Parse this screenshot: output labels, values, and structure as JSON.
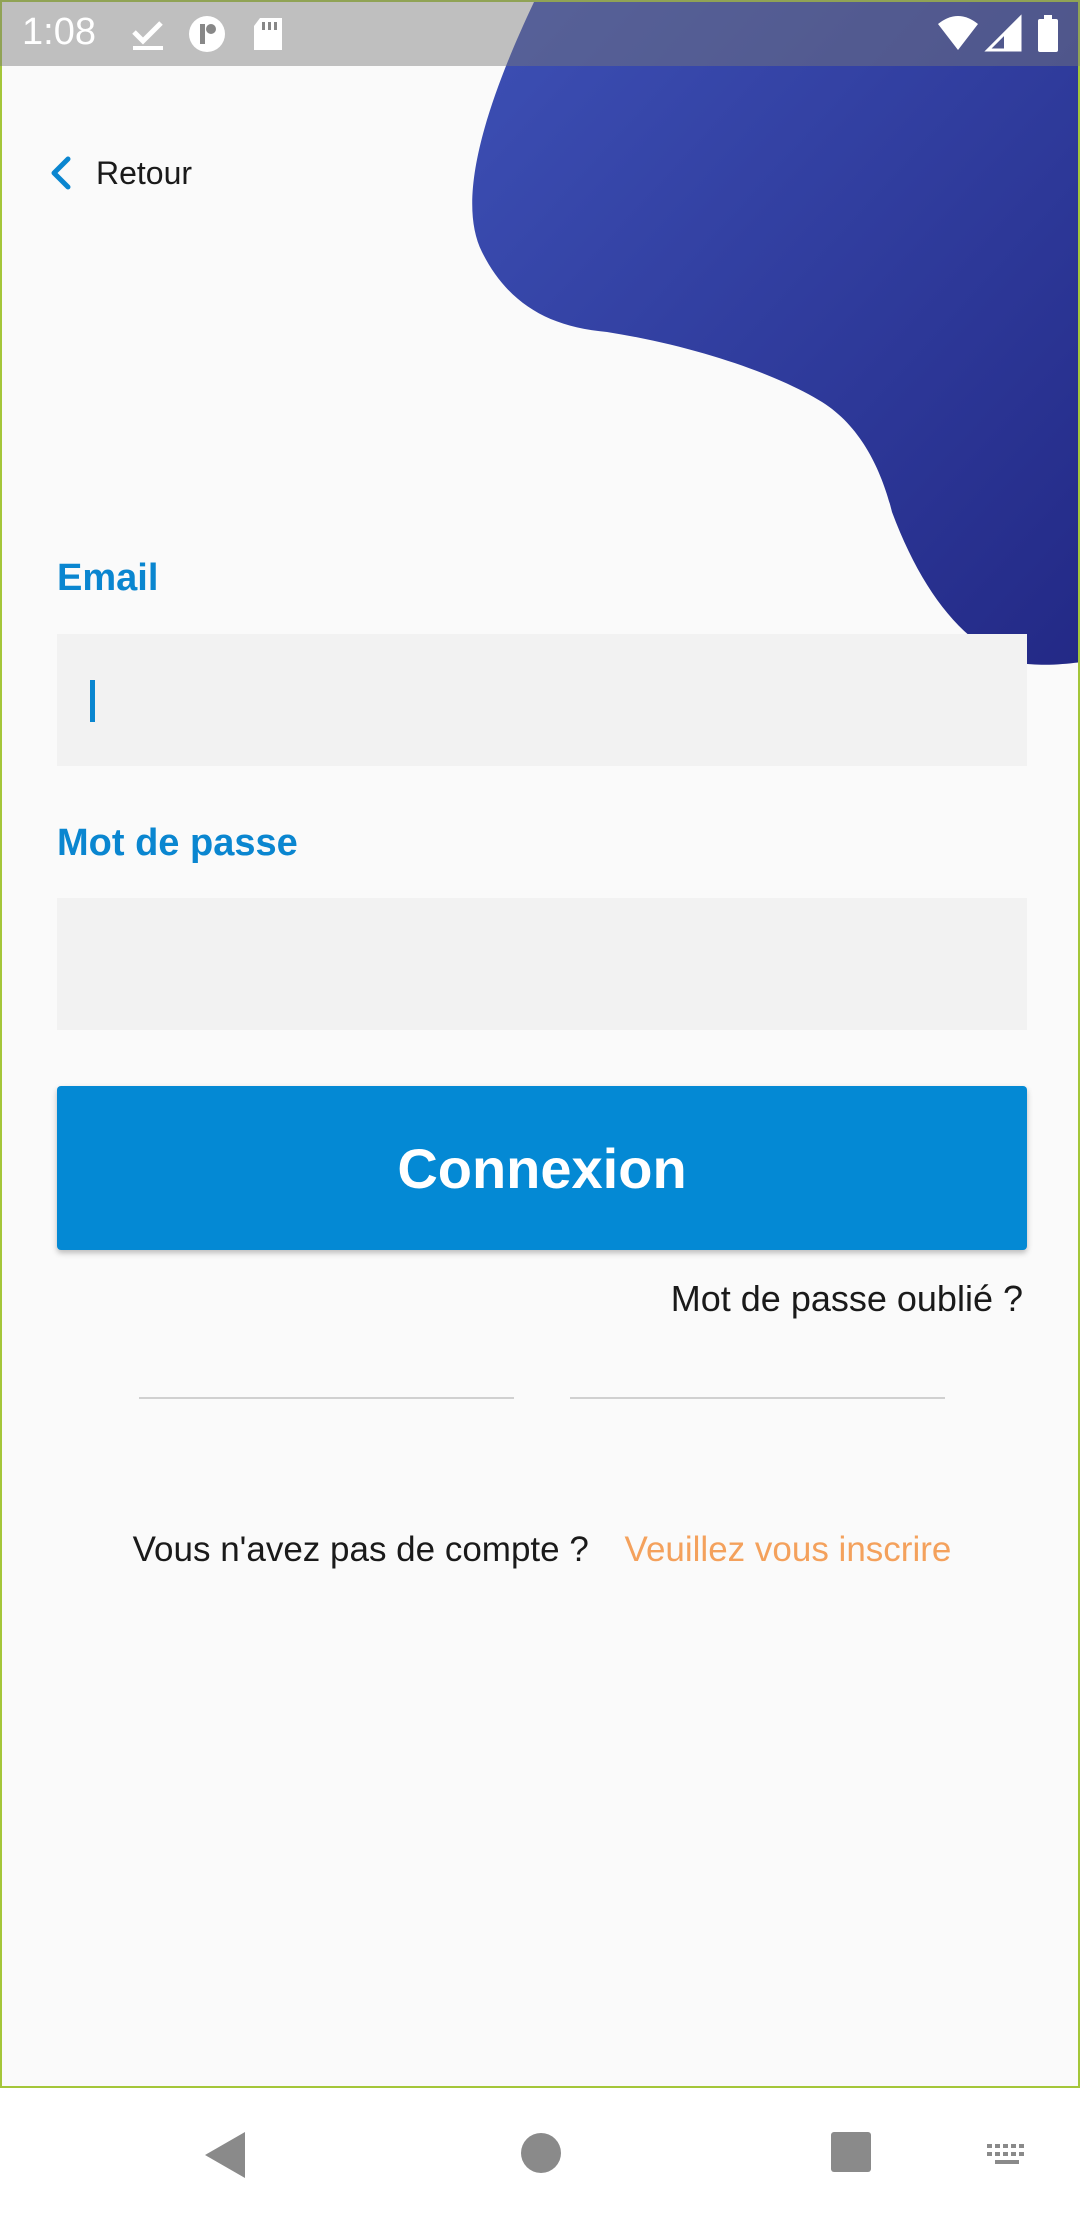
{
  "status_bar": {
    "time": "1:08",
    "icons": [
      "check-download-icon",
      "app-notification-icon",
      "sd-card-icon",
      "wifi-icon",
      "signal-icon",
      "battery-icon"
    ]
  },
  "header": {
    "back_label": "Retour"
  },
  "form": {
    "email_label": "Email",
    "email_value": "",
    "password_label": "Mot de passe",
    "password_value": "",
    "submit_label": "Connexion",
    "forgot_label": "Mot de passe oublié ?"
  },
  "signup": {
    "prompt": "Vous n'avez pas de compte ?",
    "link": "Veuillez vous inscrire"
  },
  "colors": {
    "accent": "#0a86d0",
    "button": "#0489d4",
    "link": "#f4a15c",
    "blob_start": "#3a4db3",
    "blob_end": "#252a88",
    "frame": "#a4c639"
  },
  "nav_bar": {
    "icons": [
      "back-triangle-icon",
      "home-circle-icon",
      "recents-square-icon",
      "keyboard-icon"
    ]
  }
}
